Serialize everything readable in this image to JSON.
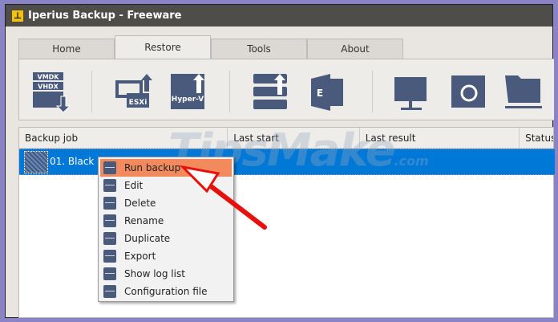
{
  "window": {
    "title": "Iperius Backup - Freeware"
  },
  "tabs": [
    {
      "label": "Home"
    },
    {
      "label": "Restore"
    },
    {
      "label": "Tools"
    },
    {
      "label": "About"
    }
  ],
  "toolbar": {
    "icons": [
      "vmdk-vhdx-restore-icon",
      "esxi-restore-icon",
      "hyper-v-restore-icon",
      "drive-restore-icon",
      "exchange-restore-icon",
      "ftp-restore-icon",
      "backup-restore-icon",
      "network-folder-restore-icon"
    ],
    "labels": {
      "vmdk": "VMDK",
      "vhdx": "VHDX",
      "esxi": "ESXi",
      "hyperv": "Hyper-V",
      "exchange": "E"
    }
  },
  "list": {
    "columns": [
      "Backup job",
      "Last start",
      "Last result",
      "Status"
    ],
    "rows": [
      {
        "name": "01. Black Sui"
      }
    ]
  },
  "context_menu": {
    "items": [
      {
        "label": "Run backup"
      },
      {
        "label": "Edit"
      },
      {
        "label": "Delete"
      },
      {
        "label": "Rename"
      },
      {
        "label": "Duplicate"
      },
      {
        "label": "Export"
      },
      {
        "label": "Show log list"
      },
      {
        "label": "Configuration file"
      }
    ]
  },
  "watermark": {
    "text": "TipsMake",
    ".com": ".com"
  },
  "colors": {
    "selection": "#0078d7",
    "menu_highlight": "#f28a5e",
    "icon": "#4a5a7c",
    "arrow": "#e8100c"
  }
}
